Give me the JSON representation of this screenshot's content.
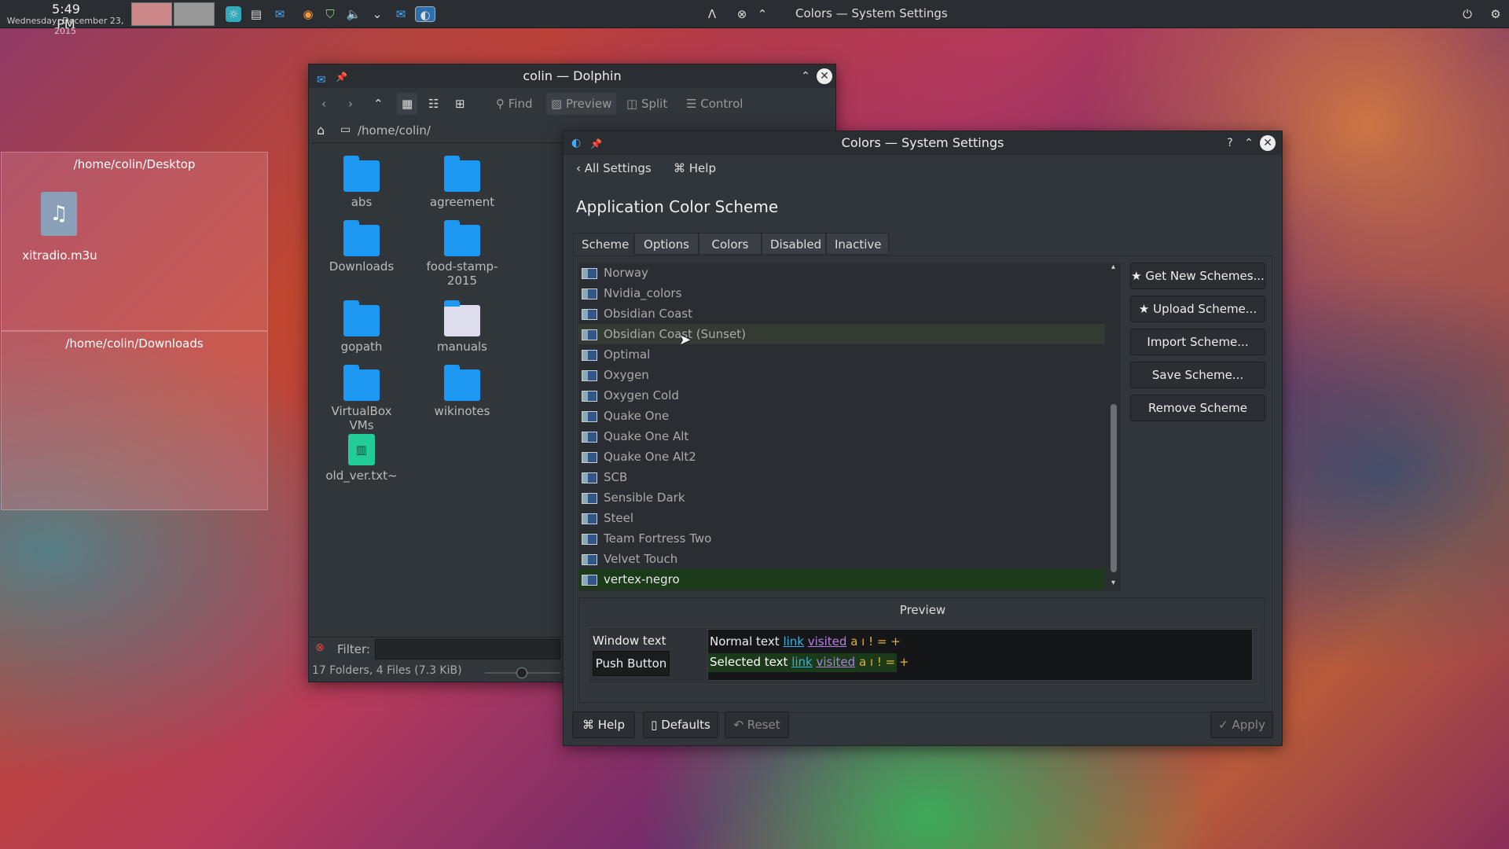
{
  "panel": {
    "time": "5:49 PM",
    "date": "Wednesday, December 23, 2015",
    "title": "Colors — System Settings"
  },
  "desktop": {
    "folder1": {
      "path": "/home/colin/Desktop",
      "file": "xitradio.m3u"
    },
    "folder2": {
      "path": "/home/colin/Downloads"
    }
  },
  "dolphin": {
    "title": "colin — Dolphin",
    "toolbar": {
      "find": "Find",
      "preview": "Preview",
      "split": "Split",
      "control": "Control"
    },
    "location": "/home/colin/",
    "items": [
      "abs",
      "agreement",
      "Downloads",
      "food-stamp-2015",
      "gopath",
      "manuals",
      "VirtualBox VMs",
      "wikinotes",
      "old_ver.txt~"
    ],
    "filter_label": "Filter:",
    "status": "17 Folders, 4 Files (7.3 KiB)"
  },
  "settings": {
    "title": "Colors — System Settings",
    "nav": {
      "back": "All Settings",
      "help": "Help"
    },
    "heading": "Application Color Scheme",
    "tabs": [
      "Scheme",
      "Options",
      "Colors",
      "Disabled",
      "Inactive"
    ],
    "schemes": [
      "Norway",
      "Nvidia_colors",
      "Obsidian Coast",
      "Obsidian Coast (Sunset)",
      "Optimal",
      "Oxygen",
      "Oxygen Cold",
      "Quake One",
      "Quake One Alt",
      "Quake One Alt2",
      "SCB",
      "Sensible Dark",
      "Steel",
      "Team Fortress Two",
      "Velvet Touch",
      "vertex-negro"
    ],
    "selected": "vertex-negro",
    "buttons": {
      "get": "Get New Schemes...",
      "upload": "Upload Scheme...",
      "import": "Import Scheme...",
      "save": "Save Scheme...",
      "remove": "Remove Scheme"
    },
    "preview": {
      "label": "Preview",
      "window_text": "Window text",
      "push_button": "Push Button",
      "normal": "Normal text",
      "selected_text": "Selected text",
      "link": "link",
      "visited": "visited",
      "chars": "a ı ! = +"
    },
    "footer": {
      "help": "Help",
      "defaults": "Defaults",
      "reset": "Reset",
      "apply": "Apply"
    }
  }
}
